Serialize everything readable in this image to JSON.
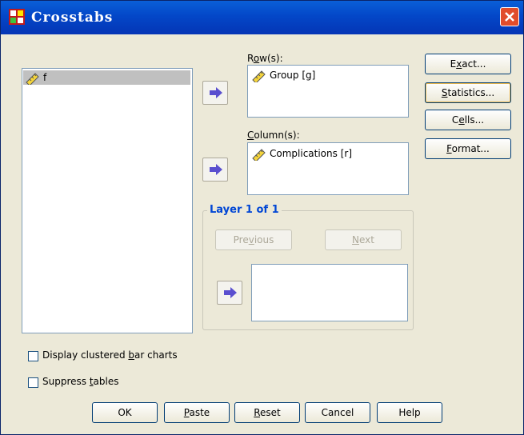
{
  "window": {
    "title": "Crosstabs"
  },
  "variables": {
    "items": [
      {
        "label": "f"
      }
    ]
  },
  "rows": {
    "label_prefix": "R",
    "label_key": "o",
    "label_suffix": "w(s):",
    "items": [
      {
        "label": "Group [g]"
      }
    ]
  },
  "columns": {
    "label_key": "C",
    "label_suffix": "olumn(s):",
    "items": [
      {
        "label": "Complications [r]"
      }
    ]
  },
  "layer": {
    "title": "Layer 1 of 1",
    "previous": {
      "pre": "Pre",
      "key": "v",
      "post": "ious"
    },
    "next": {
      "key": "N",
      "post": "ext"
    }
  },
  "side_buttons": {
    "exact": {
      "pre": "E",
      "key": "x",
      "post": "act..."
    },
    "statistics": {
      "key": "S",
      "post": "tatistics..."
    },
    "cells": {
      "pre": "C",
      "key": "e",
      "post": "lls..."
    },
    "format": {
      "key": "F",
      "post": "ormat..."
    }
  },
  "options": {
    "clustered": {
      "pre": "Display clustered ",
      "key": "b",
      "post": "ar charts"
    },
    "suppress": {
      "pre": "Suppress ",
      "key": "t",
      "post": "ables"
    }
  },
  "bottom_buttons": {
    "ok": "OK",
    "paste": {
      "key": "P",
      "post": "aste"
    },
    "reset": {
      "key": "R",
      "post": "eset"
    },
    "cancel": "Cancel",
    "help": "Help"
  },
  "colors": {
    "title_bar": "#0347c8",
    "layer_title": "#0046d5",
    "arrow": "#5a4fcf",
    "selected_item": "#c0c0c0"
  }
}
